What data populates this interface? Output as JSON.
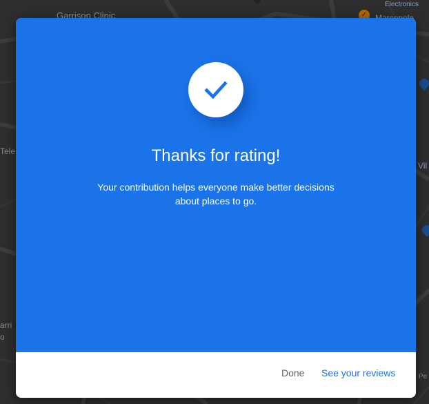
{
  "map": {
    "labels": {
      "garrison": "Garrison Clinic",
      "electronics": "Electronics",
      "marcopolo": "Marcopolo",
      "tele": "Tele",
      "vil": "Vil",
      "arr": "arri",
      "o": "o",
      "pe": "Pe"
    },
    "icons": {
      "place_pin_orange": "restaurant-pin-icon",
      "place_pin_blue": "place-pin-icon"
    }
  },
  "dialog": {
    "icon": "checkmark-icon",
    "title": "Thanks for rating!",
    "message": "Your contribution helps everyone make better decisions about places to go.",
    "buttons": {
      "done": "Done",
      "see_reviews": "See your reviews"
    },
    "colors": {
      "hero_background": "#1a73e8",
      "accent": "#1a73e8",
      "done_text": "#5f6368"
    }
  }
}
